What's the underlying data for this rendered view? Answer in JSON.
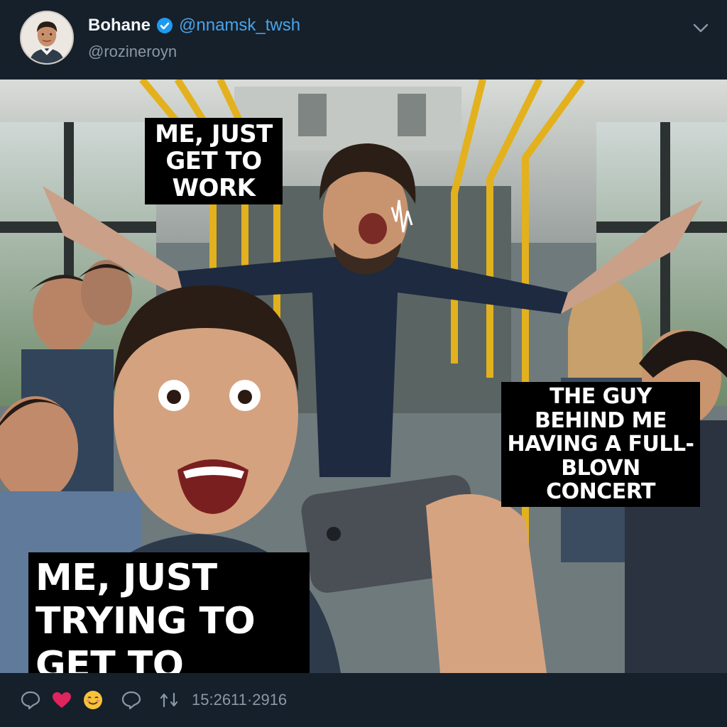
{
  "post": {
    "display_name": "Bohane",
    "handle": "@nnamsk_twsh",
    "subhandle": "@rozineroyn"
  },
  "meme": {
    "caption_top_line1": "ME, JUST",
    "caption_top_line2": "GET TO WORK",
    "caption_right": "THE GUY BEHIND ME HAVING A FULL-BLOVN CONCERT",
    "caption_bottom": "ME, JUST TRYING TO GET TO WORK"
  },
  "actions": {
    "stats": "15:2611·2916",
    "icons": [
      "reply-icon",
      "heart-icon",
      "emoji-icon",
      "comment-icon",
      "retweet-icon"
    ]
  },
  "colors": {
    "background": "#15202b",
    "accent": "#4aa3e8",
    "like": "#e0245e"
  }
}
